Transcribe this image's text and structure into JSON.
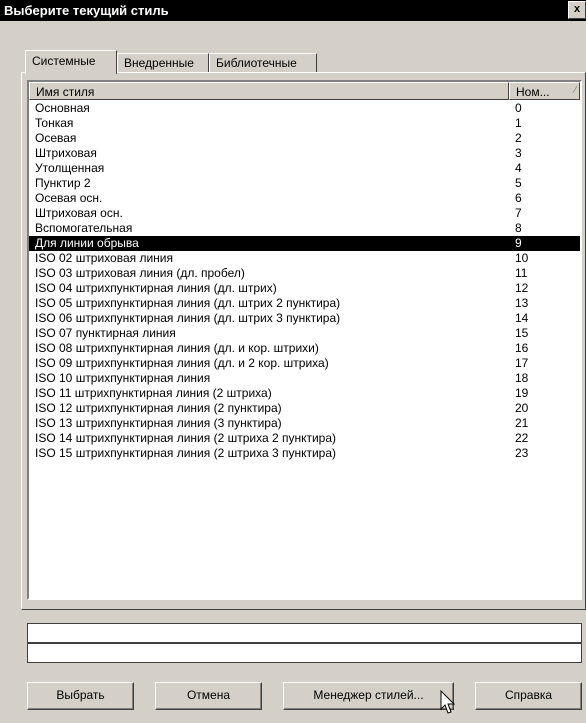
{
  "window": {
    "title": "Выберите текущий стиль",
    "close_glyph": "x"
  },
  "tabs": [
    {
      "label": "Системные",
      "active": true
    },
    {
      "label": "Внедренные",
      "active": false
    },
    {
      "label": "Библиотечные",
      "active": false
    }
  ],
  "list": {
    "columns": {
      "name": "Имя стиля",
      "number": "Ном..."
    },
    "rows": [
      {
        "name": "Основная",
        "number": "0"
      },
      {
        "name": "Тонкая",
        "number": "1"
      },
      {
        "name": "Осевая",
        "number": "2"
      },
      {
        "name": "Штриховая",
        "number": "3"
      },
      {
        "name": "Утолщенная",
        "number": "4"
      },
      {
        "name": "Пунктир 2",
        "number": "5"
      },
      {
        "name": "Осевая осн.",
        "number": "6"
      },
      {
        "name": "Штриховая осн.",
        "number": "7"
      },
      {
        "name": "Вспомогательная",
        "number": "8"
      },
      {
        "name": "Для линии обрыва",
        "number": "9",
        "selected": true
      },
      {
        "name": "ISO 02 штриховая линия",
        "number": "10"
      },
      {
        "name": "ISO 03 штриховая линия (дл. пробел)",
        "number": "11"
      },
      {
        "name": "ISO 04 штрихпунктирная линия (дл. штрих)",
        "number": "12"
      },
      {
        "name": "ISO 05 штрихпунктирная линия (дл. штрих 2 пунктира)",
        "number": "13"
      },
      {
        "name": "ISO 06 штрихпунктирная линия (дл. штрих 3 пунктира)",
        "number": "14"
      },
      {
        "name": "ISO 07 пунктирная линия",
        "number": "15"
      },
      {
        "name": "ISO 08 штрихпунктирная линия (дл. и кор. штрихи)",
        "number": "16"
      },
      {
        "name": "ISO 09 штрихпунктирная линия (дл. и 2 кор. штриха)",
        "number": "17"
      },
      {
        "name": "ISO 10 штрихпунктирная линия",
        "number": "18"
      },
      {
        "name": "ISO 11 штрихпунктирная линия (2 штриха)",
        "number": "19"
      },
      {
        "name": "ISO 12 штрихпунктирная линия (2 пунктира)",
        "number": "20"
      },
      {
        "name": "ISO 13 штрихпунктирная линия (3 пунктира)",
        "number": "21"
      },
      {
        "name": "ISO 14 штрихпунктирная линия (2 штриха 2 пунктира)",
        "number": "22"
      },
      {
        "name": "ISO 15 штрихпунктирная линия (2 штриха 3 пунктира)",
        "number": "23"
      }
    ]
  },
  "buttons": {
    "select": "Выбрать",
    "cancel": "Отмена",
    "style_manager": "Менеджер стилей...",
    "help": "Справка"
  },
  "icons": {
    "sort": "sort-ascending-icon",
    "close": "close-icon",
    "cursor": "mouse-pointer-icon"
  }
}
